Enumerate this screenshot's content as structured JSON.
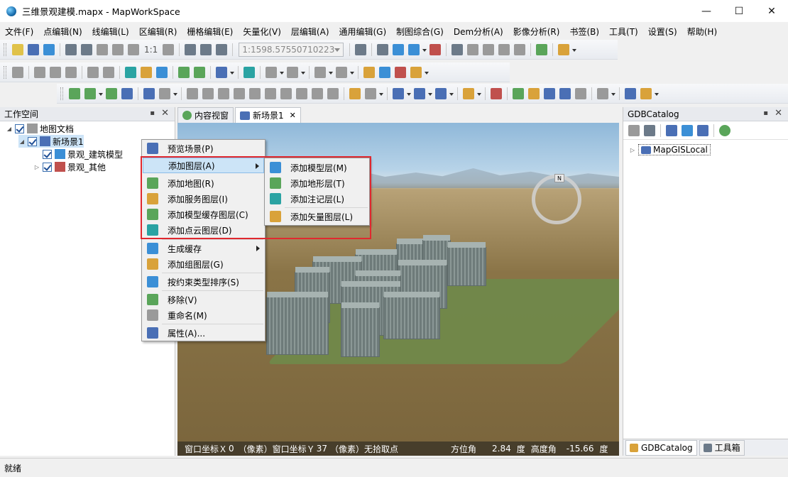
{
  "window": {
    "title": "三维景观建模.mapx - MapWorkSpace",
    "controls": [
      "—",
      "☐",
      "✕"
    ]
  },
  "menubar": [
    "文件(F)",
    "点编辑(N)",
    "线编辑(L)",
    "区编辑(R)",
    "栅格编辑(E)",
    "矢量化(V)",
    "层编辑(A)",
    "通用编辑(G)",
    "制图综合(G)",
    "Dem分析(A)",
    "影像分析(R)",
    "书签(B)",
    "工具(T)",
    "设置(S)",
    "帮助(H)"
  ],
  "toolbar": {
    "scale_value": "1:1598.57550710223",
    "ratio_label": "1:1"
  },
  "workspace_panel": {
    "title": "工作空间",
    "tree": [
      {
        "label": "地图文档"
      },
      {
        "label": "新场景1"
      },
      {
        "label": "景观_建筑模型"
      },
      {
        "label": "景观_其他"
      }
    ]
  },
  "doc_tabs": [
    {
      "label": "内容视窗"
    },
    {
      "label": "新场景1"
    }
  ],
  "context_menu": {
    "items": [
      {
        "label": "预览场景(P)",
        "icon": "preview-scene-icon"
      },
      {
        "label": "添加图层(A)",
        "icon": "add-layer-icon"
      },
      {
        "label": "添加地图(R)",
        "icon": "add-map-icon"
      },
      {
        "label": "添加服务图层(I)",
        "icon": "add-service-layer-icon"
      },
      {
        "label": "添加模型缓存图层(C)",
        "icon": "add-model-cache-icon"
      },
      {
        "label": "添加点云图层(D)",
        "icon": "add-point-cloud-icon"
      },
      {
        "label": "生成缓存",
        "icon": "generate-cache-icon"
      },
      {
        "label": "添加组图层(G)",
        "icon": "add-group-layer-icon"
      },
      {
        "label": "按约束类型排序(S)",
        "icon": "sort-icon"
      },
      {
        "label": "移除(V)",
        "icon": "remove-icon"
      },
      {
        "label": "重命名(M)",
        "icon": "rename-icon"
      },
      {
        "label": "属性(A)...",
        "icon": "properties-icon"
      }
    ]
  },
  "submenu": {
    "items": [
      {
        "label": "添加模型层(M)",
        "icon": "add-model-layer-icon"
      },
      {
        "label": "添加地形层(T)",
        "icon": "add-terrain-layer-icon"
      },
      {
        "label": "添加注记层(L)",
        "icon": "add-annotation-layer-icon"
      },
      {
        "label": "添加矢量图层(L)",
        "icon": "add-vector-layer-icon"
      }
    ]
  },
  "scene": {
    "compass_label": "N",
    "status": {
      "win_x_label": "窗口坐标Ｘ",
      "win_x_value": "0",
      "unit": "（像素）",
      "win_y_label": "窗口坐标Ｙ",
      "win_y_value": "37",
      "pick_label": "无拾取点",
      "azimuth_label": "方位角",
      "azimuth_value": "2.84",
      "deg": "度",
      "elevation_label": "高度角",
      "elevation_value": "-15.66"
    }
  },
  "catalog_panel": {
    "title": "GDBCatalog",
    "root": "MapGISLocal",
    "bottom_tabs": [
      {
        "label": "GDBCatalog"
      },
      {
        "label": "工具箱"
      }
    ]
  },
  "statusbar": {
    "text": "就绪"
  },
  "colors": {
    "highlight": "#cce4f7",
    "annotation_box": "#e0282f"
  }
}
